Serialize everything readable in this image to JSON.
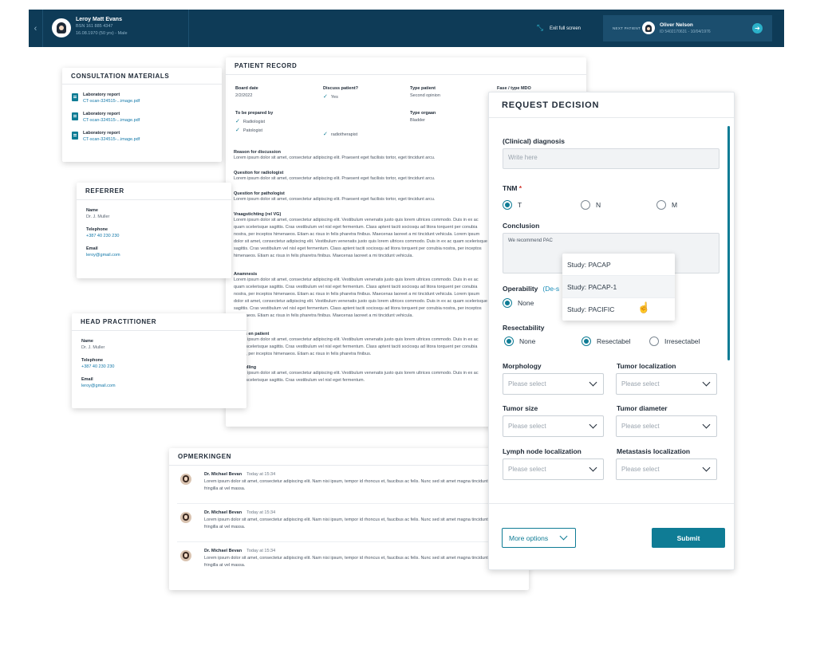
{
  "topbar": {
    "patient_name": "Leroy Matt Evans",
    "patient_bsn": "BSN 161 885 4347",
    "patient_dob": "16.08.1970 (50 yrs) - Male",
    "exit_label": "Exit full screen",
    "next_label": "NEXT PATIENT",
    "next_name": "Oliver Nelson",
    "next_sub": "ID 5402170631  -  10/04/1976"
  },
  "consult": {
    "title": "CONSULTATION MATERIALS",
    "items": [
      {
        "title": "Laboratory report",
        "file": "CT-scan-324515-...image.pdf"
      },
      {
        "title": "Laboratory report",
        "file": "CT-scan-324515-...image.pdf"
      },
      {
        "title": "Laboratory report",
        "file": "CT-scan-324515-...image.pdf"
      }
    ]
  },
  "record": {
    "title": "PATIENT RECORD",
    "board_date_label": "Board date",
    "board_date": "2/2/2022",
    "discuss_label": "Discuss patient?",
    "discuss_val": "Yes",
    "type_patient_label": "Type patient",
    "type_patient_val": "Second opinion",
    "fase_label": "Fase / type MDO",
    "prepared_label": "To be prepared by",
    "prepared_1": "Radiologist",
    "prepared_2": "Patologist",
    "prepared_3": "radiotherapist",
    "type_organ_label": "Type orgaan",
    "type_organ_val": "Bladder",
    "sections": [
      {
        "title": "Reason for discussion",
        "text": "Lorem ipsum dolor sit amet, consectetur adipiscing elit. Praesent eget facilisis tortor, eget tincidunt arcu."
      },
      {
        "title": "Quesiton for radiologist",
        "text": "Lorem ipsum dolor sit amet, consectetur adipiscing elit. Praesent eget facilisis tortor, eget tincidunt arcu."
      },
      {
        "title": "Question for pathologist",
        "text": "Lorem ipsum dolor sit amet, consectetur adipiscing elit. Praesent eget facilisis tortor, eget tincidunt arcu."
      },
      {
        "title": "Vraagstichting (rel VG)",
        "text": "Lorem ipsum dolor sit amet, consectetur adipiscing elit. Vestibulum venenatis justo quis lorem ultrices commodo. Duis in ex ac quam scelerisque sagittis. Cras vestibulum vel nisl eget fermentum. Class aptent taciti sociosqu ad litora torquent per conubia nostra, per inceptos himenaeos. Etiam ac risus in felis pharetra finibus. Maecenas laoreet a mi tincidunt vehicula. Lorem ipsum dolor sit amet, consectetur adipiscing elit. Vestibulum venenatis justo quis lorem ultrices commodo. Duis in ex ac quam scelerisque sagittis. Cras vestibulum vel nisl eget fermentum. Class aptent taciti sociosqu ad litora torquent per conubia nostra, per inceptos himenaeos. Etiam ac risus in felis pharetra finibus. Maecenas laoreet a mi tincidunt vehicula."
      },
      {
        "title": "Anamnesis",
        "text": "Lorem ipsum dolor sit amet, consectetur adipiscing elit. Vestibulum venenatis justo quis lorem ultrices commodo. Duis in ex ac quam scelerisque sagittis. Cras vestibulum vel nisl eget fermentum. Class aptent taciti sociosqu ad litora torquent per conubia nostra, per inceptos himenaeos. Etiam ac risus in felis pharetra finibus. Maecenas laoreet a mi tincidunt vehicula. Lorem ipsum dolor sit amet, consectetur adipiscing elit. Vestibulum venenatis justo quis lorem ultrices commodo. Duis in ex ac quam scelerisque sagittis. Cras vestibulum vel nisl eget fermentum. Class aptent taciti sociosqu ad litora torquent per conubia nostra, per inceptos himenaeos. Etiam ac risus in felis pharetra finibus. Maecenas laoreet a mi tincidunt vehicula."
      },
      {
        "title": "Status en patient",
        "text": "Lorem ipsum dolor sit amet, consectetur adipiscing elit. Vestibulum venenatis justo quis lorem ultrices commodo. Duis in ex ac quam scelerisque sagittis. Cras vestibulum vel nisl eget fermentum. Class aptent taciti sociosqu ad litora torquent per conubia nostra, per inceptos himenaeos. Etiam ac risus in felis pharetra finibus."
      },
      {
        "title": "Aanvulling",
        "text": "Lorem ipsum dolor sit amet, consectetur adipiscing elit. Vestibulum venenatis justo quis lorem ultrices commodo. Duis in ex ac quam scelerisque sagittis. Cras vestibulum vel nisl eget fermentum."
      }
    ]
  },
  "referrer": {
    "title": "REFERRER",
    "name_label": "Name",
    "name": "Dr. J. Muller",
    "tel_label": "Telephone",
    "tel": "+387 40 230 230",
    "email_label": "Email",
    "email": "leroy@gmail.com"
  },
  "head": {
    "title": "HEAD PRACTITIONER",
    "name_label": "Name",
    "name": "Dr. J. Muller",
    "tel_label": "Telephone",
    "tel": "+387 40 230 230",
    "email_label": "Email",
    "email": "leroy@gmail.com"
  },
  "opm": {
    "title": "OPMERKINGEN",
    "comments": [
      {
        "name": "Dr. Michael Bevan",
        "time": "Today at 15:34",
        "text": "Lorem ipsum dolor sit amet, consectetur adipiscing elit. Nam nisi ipsum, tempor id rhoncus et, faucibus ac felis. Nunc sed sit amet magna tincidunt fringilla at vel massa."
      },
      {
        "name": "Dr. Michael Bevan",
        "time": "Today at 15:34",
        "text": "Lorem ipsum dolor sit amet, consectetur adipiscing elit. Nam nisi ipsum, tempor id rhoncus et, faucibus ac felis. Nunc sed sit amet magna tincidunt fringilla at vel massa."
      },
      {
        "name": "Dr. Michael Bevan",
        "time": "Today at 15:34",
        "text": "Lorem ipsum dolor sit amet, consectetur adipiscing elit. Nam nisi ipsum, tempor id rhoncus et, faucibus ac felis. Nunc sed sit amet magna tincidunt fringilla at vel massa."
      }
    ]
  },
  "request": {
    "title": "REQUEST DECISION",
    "diagnosis_label": "(Clinical) diagnosis",
    "diagnosis_placeholder": "Write here",
    "tnm_label": "TNM",
    "tnm_star": "*",
    "tnm_options": [
      "T",
      "N",
      "M"
    ],
    "tnm_selected": "T",
    "conclusion_label": "Conclusion",
    "conclusion_value": "We recommend PAC",
    "operability_label": "Operability",
    "operability_deselect": "(De-s",
    "operability_option": "None",
    "resectability_label": "Resectability",
    "resect_options": [
      "None",
      "Resectabel",
      "Irresectabel"
    ],
    "resect_selected": "Resectabel",
    "morphology_label": "Morphology",
    "tumor_loc_label": "Tumor localization",
    "tumor_size_label": "Tumor size",
    "tumor_diam_label": "Tumor diameter",
    "lymph_label": "Lymph node localization",
    "meta_label": "Metastasis localization",
    "select_placeholder": "Please select",
    "more_label": "More options",
    "submit_label": "Submit",
    "dropdown": [
      "Study: PACAP",
      "Study: PACAP-1",
      "Study: PACIFIC"
    ]
  },
  "colors": {
    "topbar": "#0e3b57",
    "accent": "#0f7c95",
    "link": "#1177a8"
  }
}
